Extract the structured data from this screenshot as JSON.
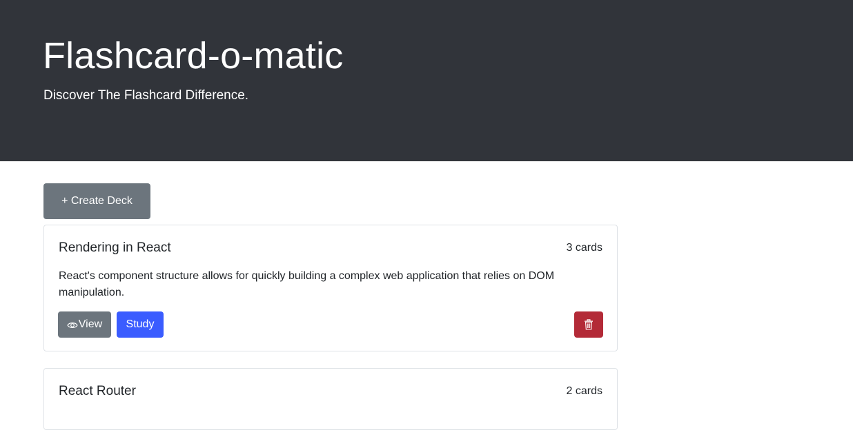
{
  "header": {
    "title": "Flashcard-o-matic",
    "tagline": "Discover The Flashcard Difference."
  },
  "toolbar": {
    "create_label": "+ Create Deck"
  },
  "decks": [
    {
      "name": "Rendering in React",
      "count": "3 cards",
      "description": "React's component structure allows for quickly building a complex web application that relies on DOM manipulation.",
      "view_label": "View",
      "study_label": "Study"
    },
    {
      "name": "React Router",
      "count": "2 cards"
    }
  ],
  "colors": {
    "header_bg": "#31343a",
    "secondary": "#6c757d",
    "primary": "#3a5cff",
    "danger": "#b32a37"
  },
  "icons": {
    "view": "eye-icon",
    "delete": "trash-icon"
  }
}
